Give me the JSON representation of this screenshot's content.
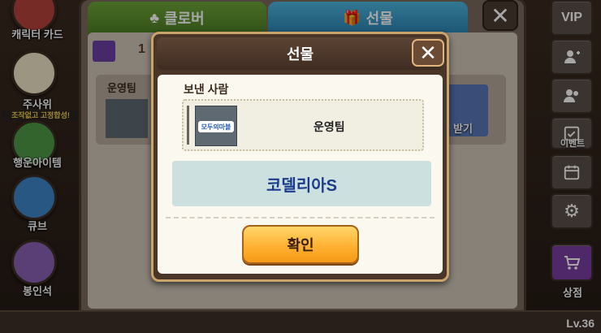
{
  "background": {
    "left_menu": [
      {
        "label": "캐릭터 카드",
        "icon": "character-card-icon"
      },
      {
        "label": "주사위",
        "icon": "dice-icon",
        "badge": "조작없고 고정합성!"
      },
      {
        "label": "행운아이템",
        "icon": "lucky-item-icon"
      },
      {
        "label": "큐브",
        "icon": "cube-icon"
      },
      {
        "label": "봉인석",
        "icon": "seal-stone-icon"
      }
    ],
    "right_menu": [
      {
        "label": "VIP",
        "icon": "vip-icon"
      },
      {
        "label": "",
        "icon": "add-friend-icon"
      },
      {
        "label": "",
        "icon": "friends-icon"
      },
      {
        "label": "이벤트",
        "icon": "event-icon"
      },
      {
        "label": "",
        "icon": "calendar-icon"
      },
      {
        "label": "",
        "icon": "settings-icon"
      },
      {
        "label": "상점",
        "icon": "shop-icon"
      }
    ],
    "tabs": [
      {
        "label": "클로버",
        "icon": "clover-icon"
      },
      {
        "label": "선물",
        "icon": "gift-icon"
      }
    ],
    "gift_count": "1",
    "row_sender": "운영팀",
    "row_action": "받기",
    "level": "Lv.36"
  },
  "modal": {
    "title": "선물",
    "sender_label": "보낸 사람",
    "sender_name": "운영팀",
    "sender_logo_text": "모두의마블",
    "recipient_name": "코델리아S",
    "confirm_label": "확인"
  }
}
